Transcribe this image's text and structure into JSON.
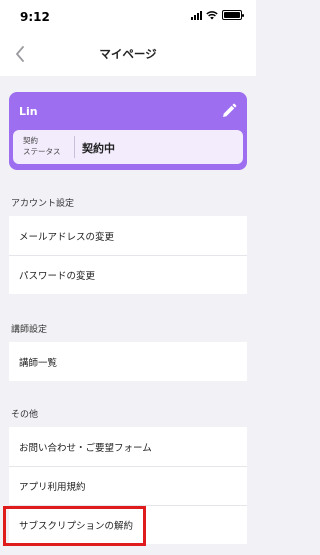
{
  "status_bar": {
    "time": "9:12"
  },
  "nav": {
    "title": "マイページ"
  },
  "profile": {
    "name": "Lin",
    "status_label_line1": "契約",
    "status_label_line2": "ステータス",
    "status_value": "契約中",
    "accent_color": "#9d6ef0"
  },
  "sections": {
    "account": {
      "heading": "アカウント設定",
      "items": [
        "メールアドレスの変更",
        "パスワードの変更"
      ]
    },
    "instructor": {
      "heading": "講師設定",
      "items": [
        "講師一覧"
      ]
    },
    "other": {
      "heading": "その他",
      "items": [
        "お問い合わせ・ご要望フォーム",
        "アプリ利用規約",
        "サブスクリプションの解約"
      ]
    }
  },
  "highlight_color": "#e01b1b"
}
